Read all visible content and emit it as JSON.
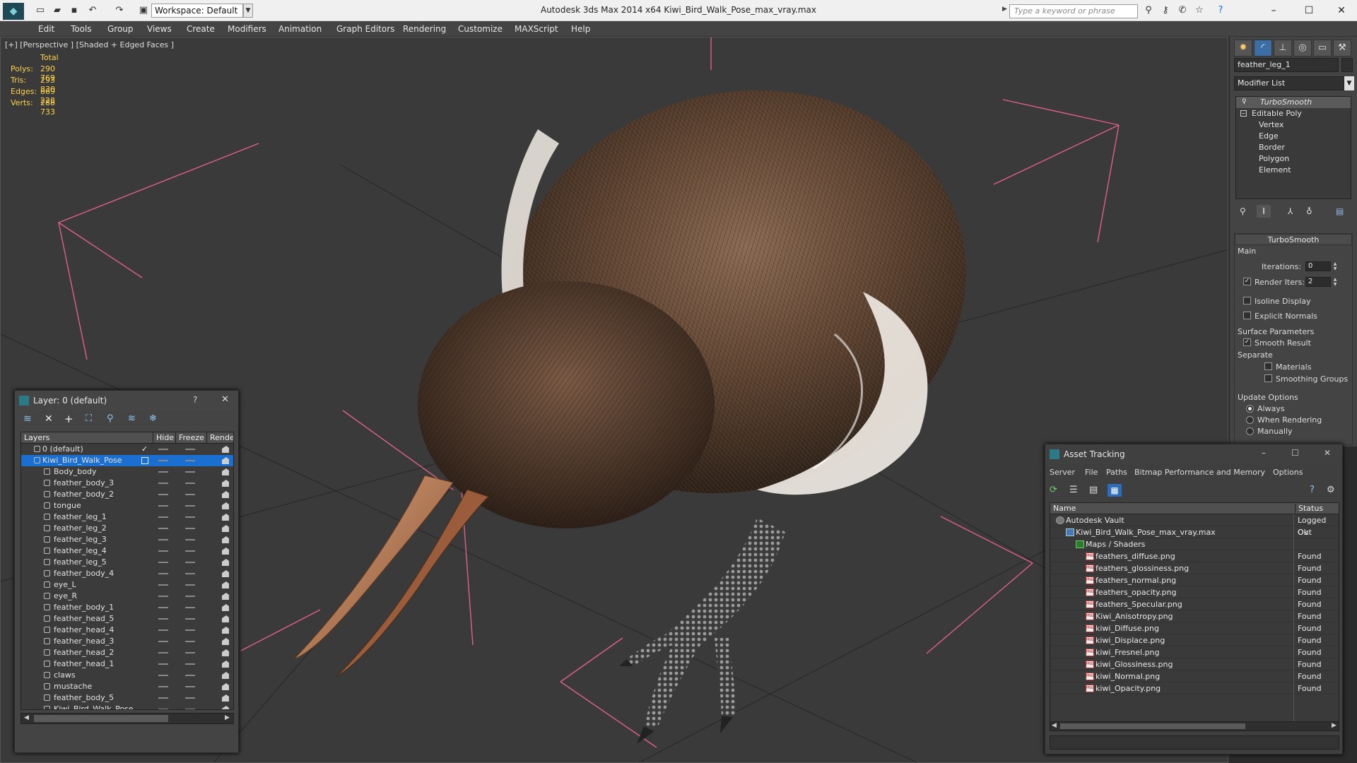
{
  "titlebar": {
    "workspace": "Workspace: Default",
    "title": "Autodesk 3ds Max 2014 x64      Kiwi_Bird_Walk_Pose_max_vray.max",
    "search_placeholder": "Type a keyword or phrase"
  },
  "menu": [
    "Edit",
    "Tools",
    "Group",
    "Views",
    "Create",
    "Modifiers",
    "Animation",
    "Graph Editors",
    "Rendering",
    "Customize",
    "MAXScript",
    "Help"
  ],
  "viewport": {
    "label": "[+] [Perspective ] [Shaded + Edged Faces ]",
    "stats": {
      "total_label": "Total",
      "polys_label": "Polys:",
      "polys": "290 769",
      "tris_label": "Tris:",
      "tris": "293 830",
      "edges_label": "Edges:",
      "edges": "869 228",
      "verts_label": "Verts:",
      "verts": "288 733"
    }
  },
  "command_panel": {
    "object_name": "feather_leg_1",
    "modifier_list": "Modifier List",
    "stack": [
      "TurboSmooth",
      "Editable Poly",
      "Vertex",
      "Edge",
      "Border",
      "Polygon",
      "Element"
    ],
    "rollout_title": "TurboSmooth",
    "main_label": "Main",
    "iterations_label": "Iterations:",
    "iterations": "0",
    "render_iters_label": "Render Iters:",
    "render_iters": "2",
    "isoline": "Isoline Display",
    "explicit": "Explicit Normals",
    "surface_params": "Surface Parameters",
    "smooth_result": "Smooth Result",
    "separate": "Separate",
    "materials": "Materials",
    "smoothing_groups": "Smoothing Groups",
    "update_options": "Update Options",
    "always": "Always",
    "when_rendering": "When Rendering",
    "manually": "Manually"
  },
  "layer_dialog": {
    "title": "Layer: 0 (default)",
    "help": "?",
    "columns": {
      "layers": "Layers",
      "hide": "Hide",
      "freeze": "Freeze",
      "render": "Rende"
    },
    "rows": [
      "0 (default)",
      "Kiwi_Bird_Walk_Pose",
      "Body_body",
      "feather_body_3",
      "feather_body_2",
      "tongue",
      "feather_leg_1",
      "feather_leg_2",
      "feather_leg_3",
      "feather_leg_4",
      "feather_leg_5",
      "feather_body_4",
      "eye_L",
      "eye_R",
      "feather_body_1",
      "feather_head_5",
      "feather_head_4",
      "feather_head_3",
      "feather_head_2",
      "feather_head_1",
      "claws",
      "mustache",
      "feather_body_5",
      "Kiwi_Bird_Walk_Pose"
    ]
  },
  "asset_dialog": {
    "title": "Asset Tracking",
    "menu": [
      "Server",
      "File",
      "Paths",
      "Bitmap Performance and Memory",
      "Options"
    ],
    "columns": {
      "name": "Name",
      "status": "Status"
    },
    "rows": [
      {
        "name": "Autodesk Vault",
        "status": "Logged Out"
      },
      {
        "name": "Kiwi_Bird_Walk_Pose_max_vray.max",
        "status": "Ok"
      },
      {
        "name": "Maps / Shaders",
        "status": ""
      },
      {
        "name": "feathers_diffuse.png",
        "status": "Found"
      },
      {
        "name": "feathers_glossiness.png",
        "status": "Found"
      },
      {
        "name": "feathers_normal.png",
        "status": "Found"
      },
      {
        "name": "feathers_opacity.png",
        "status": "Found"
      },
      {
        "name": "feathers_Specular.png",
        "status": "Found"
      },
      {
        "name": "Kiwi_Anisotropy.png",
        "status": "Found"
      },
      {
        "name": "kiwi_Diffuse.png",
        "status": "Found"
      },
      {
        "name": "kiwi_Displace.png",
        "status": "Found"
      },
      {
        "name": "kiwi_Fresnel.png",
        "status": "Found"
      },
      {
        "name": "kiwi_Glossiness.png",
        "status": "Found"
      },
      {
        "name": "kiwi_Normal.png",
        "status": "Found"
      },
      {
        "name": "kiwi_Opacity.png",
        "status": "Found"
      }
    ]
  },
  "colors": {
    "accent": "#1b6fd0",
    "stats": "#ffd24a",
    "bbox": "#e0608a"
  }
}
